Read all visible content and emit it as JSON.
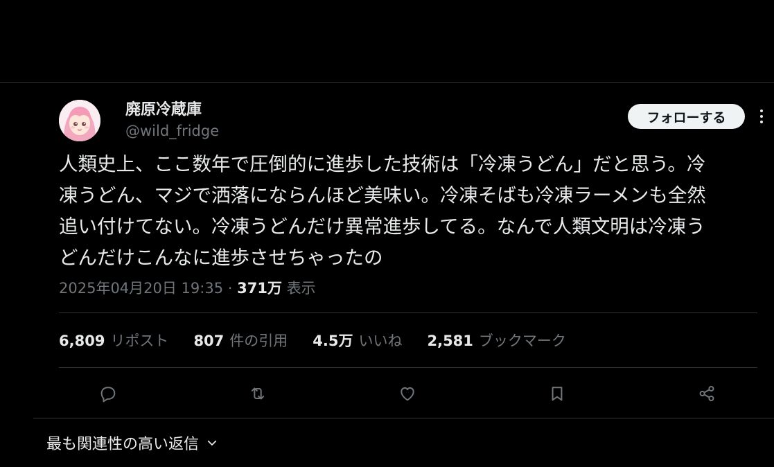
{
  "author": {
    "name": "廃原冷蔵庫",
    "handle": "@wild_fridge"
  },
  "follow_label": "フォローする",
  "tweet": {
    "lines": [
      "人類史上、ここ数年で圧倒的に進歩した技術は「冷凍うどん」だと思う。冷",
      "凍うどん、マジで洒落にならんほど美味い。冷凍そばも冷凍ラーメンも全然",
      "追い付けてない。冷凍うどんだけ異常進歩してる。なんで人類文明は冷凍う",
      "どんだけこんなに進歩させちゃったの"
    ],
    "timestamp": "2025年04月20日 19:35",
    "separator": "·",
    "views": "371万",
    "views_label": "表示"
  },
  "stats": [
    {
      "count": "6,809",
      "label": "リポスト"
    },
    {
      "count": "807",
      "label": "件の引用"
    },
    {
      "count": "4.5万",
      "label": "いいね"
    },
    {
      "count": "2,581",
      "label": "ブックマーク"
    }
  ],
  "actions": [
    "reply-icon",
    "retweet-icon",
    "like-icon",
    "bookmark-icon",
    "share-icon"
  ],
  "sort": {
    "label": "最も関連性の高い返信"
  },
  "colors": {
    "background": "#000000",
    "text": "#e7e9ea",
    "muted": "#71767b",
    "divider": "#2f3336",
    "follow_bg": "#eff3f4"
  }
}
